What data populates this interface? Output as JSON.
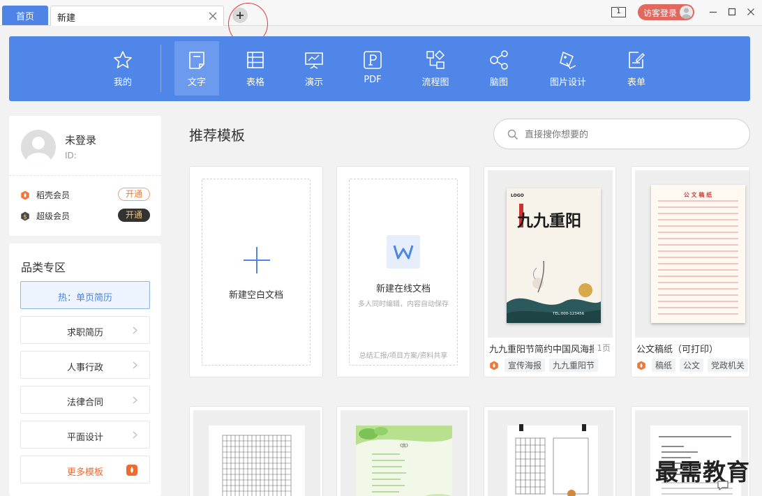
{
  "titlebar": {
    "home_tab": "首页",
    "active_tab": "新建",
    "window_badge": "1",
    "login_label": "访客登录"
  },
  "toolbar": {
    "items": [
      {
        "label": "我的",
        "icon": "star-icon"
      },
      {
        "label": "文字",
        "icon": "document-icon"
      },
      {
        "label": "表格",
        "icon": "table-icon"
      },
      {
        "label": "演示",
        "icon": "presentation-icon"
      },
      {
        "label": "PDF",
        "icon": "pdf-icon"
      },
      {
        "label": "流程图",
        "icon": "flowchart-icon"
      },
      {
        "label": "脑图",
        "icon": "mindmap-icon"
      },
      {
        "label": "图片设计",
        "icon": "image-design-icon"
      },
      {
        "label": "表单",
        "icon": "form-icon"
      }
    ],
    "selected": "文字"
  },
  "user": {
    "name": "未登录",
    "id_label": "ID:",
    "members": [
      {
        "name": "稻壳会员",
        "action": "开通"
      },
      {
        "name": "超级会员",
        "action": "开通"
      }
    ]
  },
  "categories": {
    "title": "品类专区",
    "items": [
      "热：单页简历",
      "求职简历",
      "人事行政",
      "法律合同",
      "平面设计",
      "更多模板"
    ]
  },
  "main": {
    "section_title": "推荐模板",
    "search_placeholder": "直接搜你想要的",
    "new_blank": "新建空白文档",
    "new_online": "新建在线文档",
    "new_online_sub": "多人同时编辑，内容自动保存",
    "new_online_foot": "总结汇报/项目方案/资料共享",
    "templates": [
      {
        "title": "九九重阳节简约中国风海报",
        "pages": "1页",
        "tags": [
          "宣传海报",
          "九九重阳节"
        ]
      },
      {
        "title": "公文稿纸（可打印）",
        "tags": [
          "稿纸",
          "公文",
          "党政机关"
        ]
      }
    ]
  },
  "thumbs": {
    "poster_logo": "LOGO",
    "poster_title": "九九重阳",
    "poster_tel": "TEL:000-123456",
    "paper_title": "公 文 稿 纸",
    "green_title": "《我》"
  },
  "watermark": "最需教育",
  "colors": {
    "accent": "#4f86e8",
    "login": "#e0685f",
    "annotation": "#e03a3a",
    "orange": "#ec7a3e"
  }
}
